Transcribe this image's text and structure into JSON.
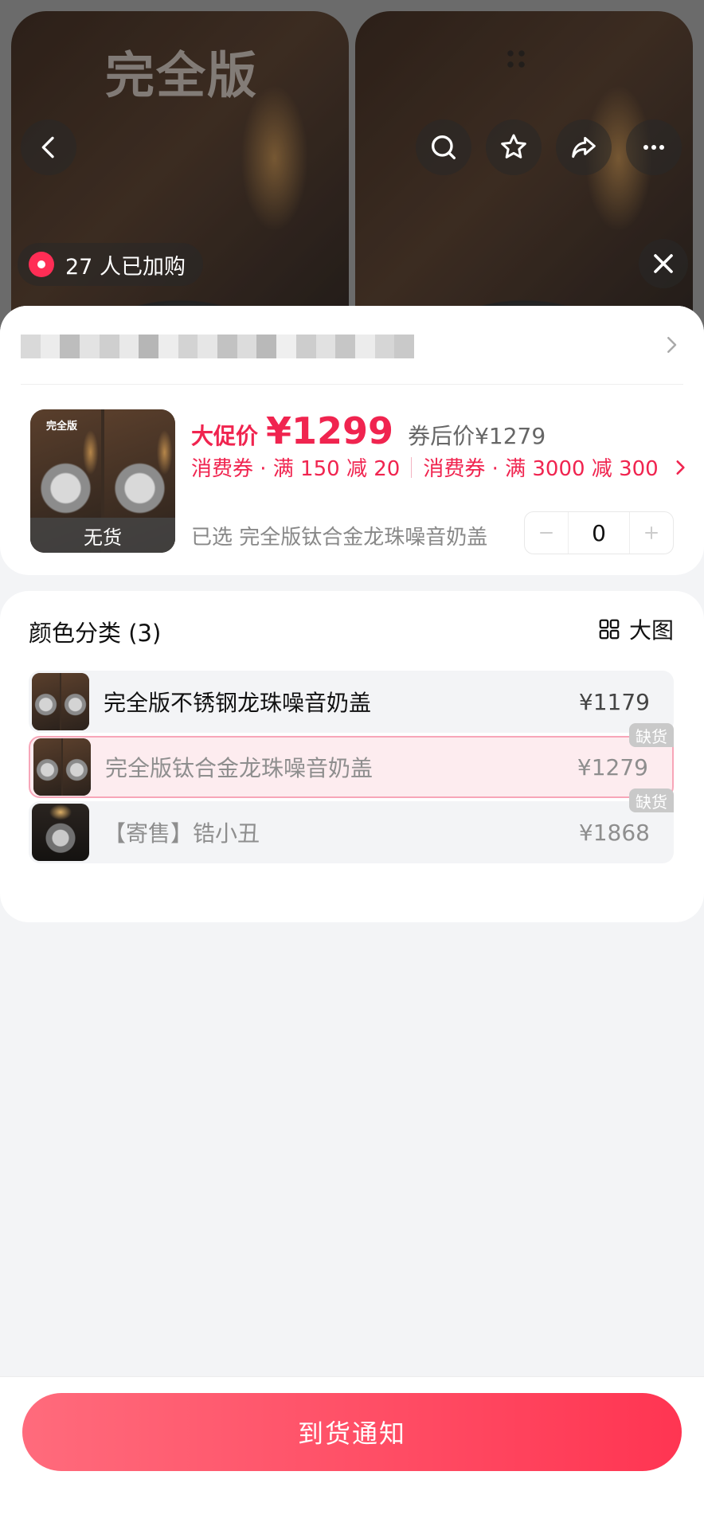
{
  "gallery": {
    "left_watermark": "完全版",
    "buyers_text": "27 人已加购"
  },
  "product": {
    "thumb_tag": "完全版",
    "thumb_status": "无货",
    "price_label": "大促价",
    "price": "¥1299",
    "after_coupon": "券后价¥1279",
    "coupons": [
      "消费券 · 满 150 减 20",
      "消费券 · 满 3000 减 300"
    ],
    "selected_prefix": "已选",
    "selected_value": "完全版钛合金龙珠噪音奶盖",
    "quantity": "0"
  },
  "options": {
    "title": "颜色分类 (3)",
    "bigview_label": "大图",
    "stock_badge": "缺货",
    "items": [
      {
        "name": "完全版不锈钢龙珠噪音奶盖",
        "price": "¥1179"
      },
      {
        "name": "完全版钛合金龙珠噪音奶盖",
        "price": "¥1279"
      },
      {
        "name": "【寄售】锆小丑",
        "price": "¥1868"
      }
    ]
  },
  "footer": {
    "cta_label": "到货通知"
  },
  "colors": {
    "accent": "#f0244f",
    "cta_start": "#ff6b7c",
    "cta_end": "#ff3552"
  }
}
